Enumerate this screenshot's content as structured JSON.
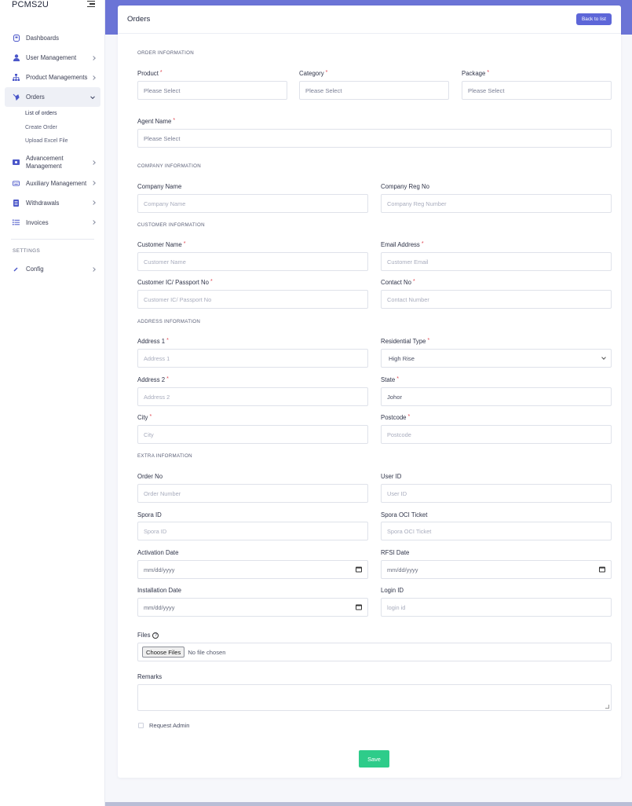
{
  "app": {
    "brand": "PCMS2U"
  },
  "sidebar": {
    "items": [
      {
        "label": "Dashboards",
        "icon": "dashboard-icon"
      },
      {
        "label": "User Management",
        "icon": "user-icon"
      },
      {
        "label": "Product Managements",
        "icon": "sitemap-icon"
      },
      {
        "label": "Orders",
        "icon": "orders-icon"
      },
      {
        "label": "Advancement Management",
        "icon": "money-icon"
      },
      {
        "label": "Auxiliary Management",
        "icon": "keyboard-icon"
      },
      {
        "label": "Withdrawals",
        "icon": "withdraw-icon"
      },
      {
        "label": "Invoices",
        "icon": "list-icon"
      }
    ],
    "orders_sub": [
      "List of orders",
      "Create Order",
      "Upload Excel File"
    ],
    "settings_label": "SETTINGS",
    "config_label": "Config"
  },
  "page": {
    "title": "Orders",
    "back_label": "Back to list"
  },
  "sections": {
    "order": "ORDER INFORMATION",
    "company": "COMPANY INFORMATION",
    "customer": "CUSTOMER INFORMATION",
    "address": "ADDRESS INFORMATION",
    "extra": "EXTRA INFORMATION"
  },
  "fields": {
    "product": {
      "label": "Product",
      "placeholder": "Please Select"
    },
    "category": {
      "label": "Category",
      "placeholder": "Please Select"
    },
    "package": {
      "label": "Package",
      "placeholder": "Please Select"
    },
    "agent": {
      "label": "Agent Name",
      "placeholder": "Please Select"
    },
    "company_name": {
      "label": "Company Name",
      "placeholder": "Company Name"
    },
    "company_reg": {
      "label": "Company Reg No",
      "placeholder": "Company Reg Number"
    },
    "customer_name": {
      "label": "Customer Name",
      "placeholder": "Customer Name"
    },
    "email": {
      "label": "Email Address",
      "placeholder": "Customer Email"
    },
    "ic": {
      "label": "Customer IC/ Passport No",
      "placeholder": "Customer IC/ Passport No"
    },
    "contact": {
      "label": "Contact No",
      "placeholder": "Contact Number"
    },
    "address1": {
      "label": "Address 1",
      "placeholder": "Address 1"
    },
    "residential": {
      "label": "Residential Type",
      "value": "High Rise"
    },
    "address2": {
      "label": "Address 2",
      "placeholder": "Address 2"
    },
    "state": {
      "label": "State",
      "value": "Johor"
    },
    "city": {
      "label": "City",
      "placeholder": "City"
    },
    "postcode": {
      "label": "Postcode",
      "placeholder": "Postcode"
    },
    "order_no": {
      "label": "Order No",
      "placeholder": "Order Number"
    },
    "user_id": {
      "label": "User ID",
      "placeholder": "User ID"
    },
    "spora_id": {
      "label": "Spora ID",
      "placeholder": "Spora ID"
    },
    "spora_oci": {
      "label": "Spora OCI Ticket",
      "placeholder": "Spora OCI Ticket"
    },
    "activation": {
      "label": "Activation Date",
      "placeholder": "mm/dd/yyyy"
    },
    "rfsi": {
      "label": "RFSI Date",
      "placeholder": "mm/dd/yyyy"
    },
    "installation": {
      "label": "Installation Date",
      "placeholder": "mm/dd/yyyy"
    },
    "login_id": {
      "label": "Login ID",
      "placeholder": "login id"
    },
    "files": {
      "label": "Files",
      "button": "Choose Files",
      "status": "No file chosen"
    },
    "remarks": {
      "label": "Remarks"
    },
    "request_admin": {
      "label": "Request Admin"
    }
  },
  "actions": {
    "save": "Save"
  },
  "required_mark": "*",
  "colors": {
    "accent": "#5d66d8",
    "topbar": "#6b74d6",
    "save": "#2ecc8a",
    "required": "#e0434f"
  }
}
